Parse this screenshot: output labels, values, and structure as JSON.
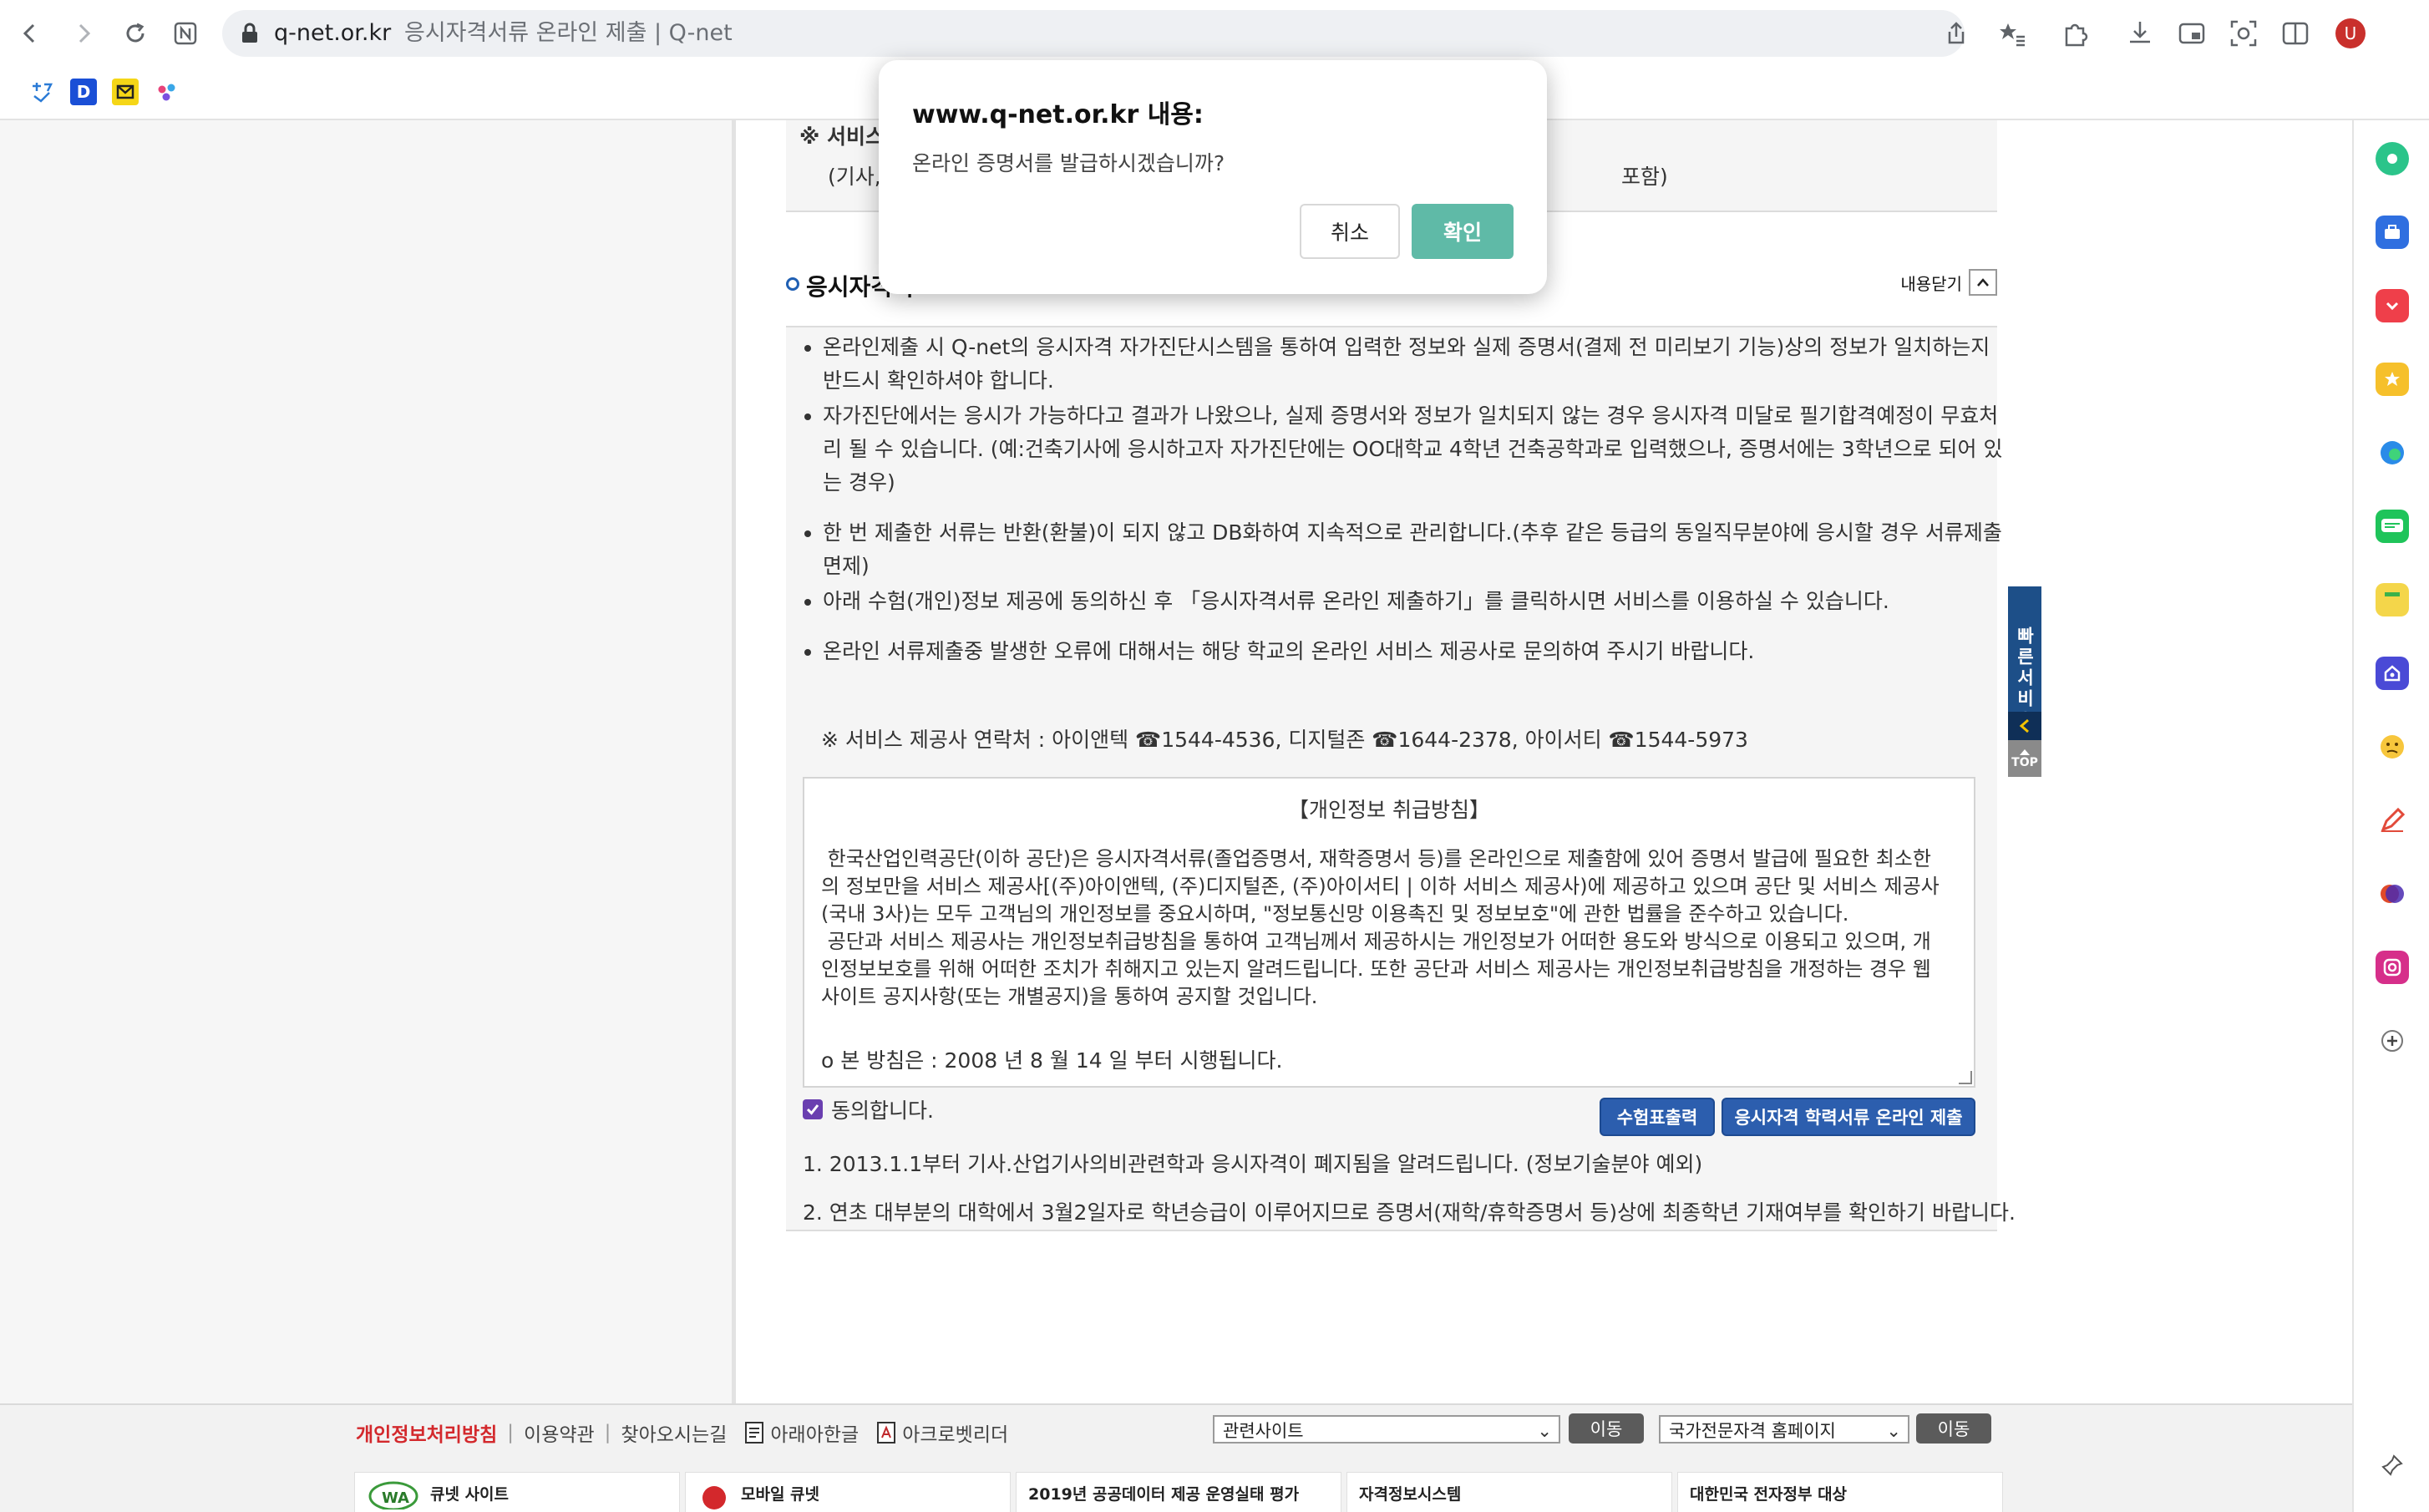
{
  "browser": {
    "url_host": "q-net.or.kr",
    "page_title": "응시자격서류 온라인 제출 | Q-net",
    "profile_initial": "U",
    "bookmarks": [
      {
        "label": "D",
        "color": "#1a4fd6"
      },
      {
        "label": "",
        "color": "#f5d617"
      }
    ]
  },
  "page": {
    "prev_note": "※ 서비스",
    "prev_sub": "(기사,",
    "prev_sub_tail": "포함)",
    "section_title": "응시자격서",
    "close_label": "내용닫기",
    "notices": [
      "온라인제출 시 Q-net의 응시자격 자가진단시스템을 통하여 입력한 정보와 실제 증명서(결제 전 미리보기 기능)상의 정보가 일치하는지 반드시 확인하셔야 합니다.",
      "자가진단에서는 응시가 가능하다고 결과가 나왔으나, 실제 증명서와 정보가 일치되지 않는 경우 응시자격 미달로 필기합격예정이 무효처리 될 수 있습니다. (예:건축기사에 응시하고자 자가진단에는 OO대학교 4학년 건축공학과로 입력했으나, 증명서에는 3학년으로 되어 있는 경우)",
      "한 번 제출한 서류는 반환(환불)이 되지 않고 DB화하여 지속적으로 관리합니다.(추후 같은 등급의 동일직무분야에 응시할 경우 서류제출 면제)",
      "아래 수험(개인)정보 제공에 동의하신 후 「응시자격서류 온라인 제출하기」를 클릭하시면 서비스를 이용하실 수 있습니다.",
      "온라인 서류제출중 발생한 오류에 대해서는 해당 학교의 온라인 서비스 제공사로 문의하여 주시기 바랍니다."
    ],
    "provider_note": "※ 서비스 제공사 연락처 : 아이앤텍 ☎1544-4536, 디지털존 ☎1644-2378, 아이서티 ☎1544-5973",
    "privacy": {
      "title": "【개인정보 취급방침】",
      "body": " 한국산업인력공단(이하 공단)은 응시자격서류(졸업증명서, 재학증명서 등)를 온라인으로 제출함에 있어 증명서 발급에 필요한 최소한의 정보만을 서비스 제공사[(주)아이앤텍, (주)디지털존, (주)아이서티 | 이하 서비스 제공사)에 제공하고 있으며 공단 및 서비스 제공사(국내 3사)는 모두 고객님의 개인정보를 중요시하며, \"정보통신망 이용촉진 및 정보보호\"에 관한 법률을 준수하고 있습니다.\n 공단과 서비스 제공사는 개인정보취급방침을 통하여 고객님께서 제공하시는 개인정보가 어떠한 용도와 방식으로 이용되고 있으며, 개인정보보호를 위해 어떠한 조치가 취해지고 있는지 알려드립니다. 또한 공단과 서비스 제공사는 개인정보취급방침을 개정하는 경우 웹사이트 공지사항(또는 개별공지)을 통하여 공지할 것입니다.",
      "date": "o 본 방침은 : 2008 년 8 월 14 일 부터 시행됩니다."
    },
    "agree_label": "동의합니다.",
    "print_button": "수험표출력",
    "submit_button": "응시자격 학력서류 온라인 제출",
    "foot_notes": [
      "1. 2013.1.1부터 기사.산업기사의비관련학과 응시자격이 폐지됨을 알려드립니다. (정보기술분야 예외)",
      "2. 연초 대부분의 대학에서 3월2일자로 학년승급이 이루어지므로 증명서(재학/휴학증명서 등)상에 최종학년 기재여부를 확인하기 바랍니다."
    ],
    "quick_service": "빠른서비스",
    "top_label": "TOP"
  },
  "footer": {
    "privacy_link": "개인정보처리방침",
    "terms_link": "이용약관",
    "directions_link": "찾아오시는길",
    "hangul_link": "아래아한글",
    "acrobat_link": "아크로벳리더",
    "related_select": "관련사이트",
    "national_select": "국가전문자격 홈페이지",
    "move_label": "이동",
    "banners": [
      "큐넷 사이트",
      "모바일 큐넷",
      "2019년 공공데이터 제공 운영실태 평가",
      "자격정보시스템",
      "대한민국 전자정부 대상"
    ]
  },
  "dialog": {
    "title": "www.q-net.or.kr 내용:",
    "message": "온라인 증명서를 발급하시겠습니까?",
    "cancel": "취소",
    "ok": "확인"
  },
  "colors": {
    "accent_green": "#5fbaa7",
    "button_blue": "#2c5eae",
    "footer_red": "#d3282c"
  }
}
